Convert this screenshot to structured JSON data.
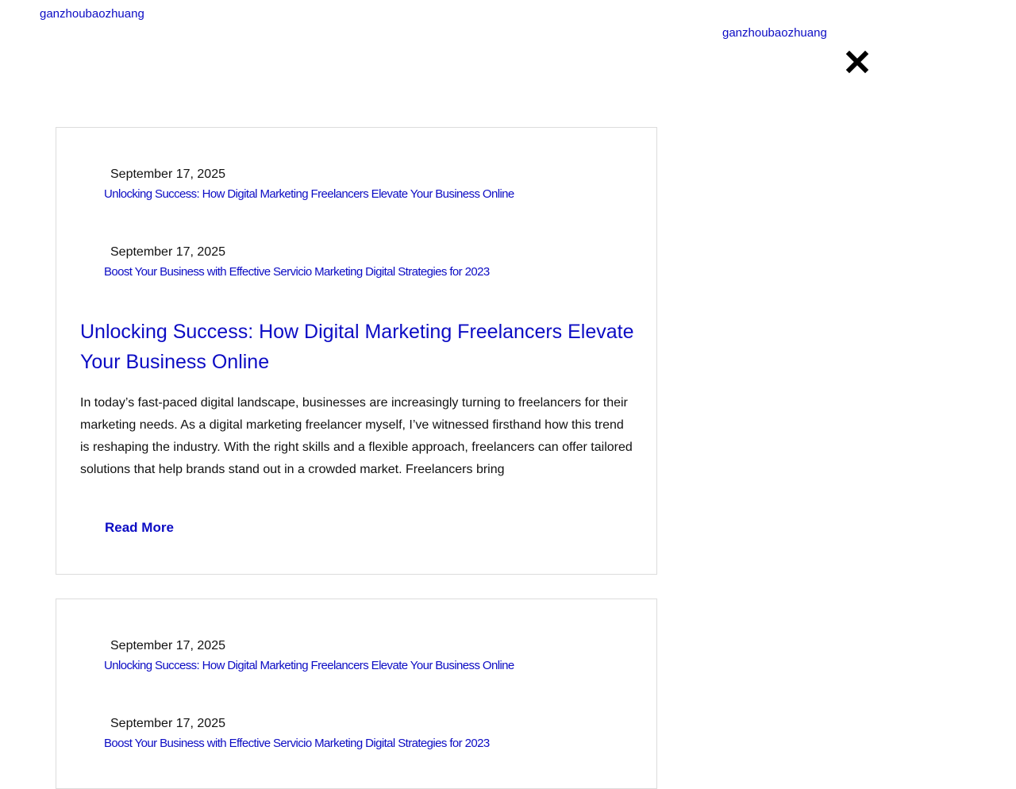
{
  "header": {
    "site_title": "ganzhoubaozhuang"
  },
  "offcanvas": {
    "site_title": "ganzhoubaozhuang",
    "close_icon": "close-x-icon"
  },
  "posts": [
    {
      "recent": [
        {
          "date": "September 17, 2025",
          "title": "Unlocking Success: How Digital Marketing Freelancers Elevate Your Business Online"
        },
        {
          "date": "September 17, 2025",
          "title": "Boost Your Business with Effective Servicio Marketing Digital Strategies for 2023"
        }
      ],
      "title": "Unlocking Success: How Digital Marketing Freelancers Elevate Your Business Online",
      "excerpt": "In today’s fast-paced digital landscape, businesses are increasingly turning to freelancers for their marketing needs. As a digital marketing freelancer myself, I’ve witnessed firsthand how this trend is reshaping the industry. With the right skills and a flexible approach, freelancers can offer tailored solutions that help brands stand out in a crowded market. Freelancers bring",
      "read_more": "Read More"
    },
    {
      "recent": [
        {
          "date": "September 17, 2025",
          "title": "Unlocking Success: How Digital Marketing Freelancers Elevate Your Business Online"
        },
        {
          "date": "September 17, 2025",
          "title": "Boost Your Business with Effective Servicio Marketing Digital Strategies for 2023"
        }
      ]
    }
  ],
  "colors": {
    "link": "#0c0cc4",
    "text": "#111111",
    "border": "#dcdcdc"
  }
}
